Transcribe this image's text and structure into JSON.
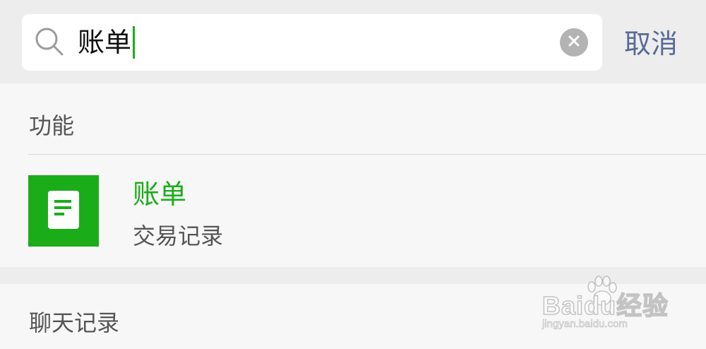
{
  "search": {
    "query": "账单",
    "cancel_label": "取消"
  },
  "sections": {
    "function": {
      "title": "功能",
      "result": {
        "title": "账单",
        "subtitle": "交易记录",
        "icon": "document-icon",
        "icon_color": "#1aad19"
      }
    },
    "chat": {
      "title": "聊天记录"
    }
  },
  "watermark": {
    "main": "Baidu经验",
    "sub": "jingyan.baidu.com"
  },
  "colors": {
    "accent_green": "#1aad19",
    "link_blue": "#576b95",
    "background": "#ededed",
    "panel": "#f7f7f7"
  }
}
